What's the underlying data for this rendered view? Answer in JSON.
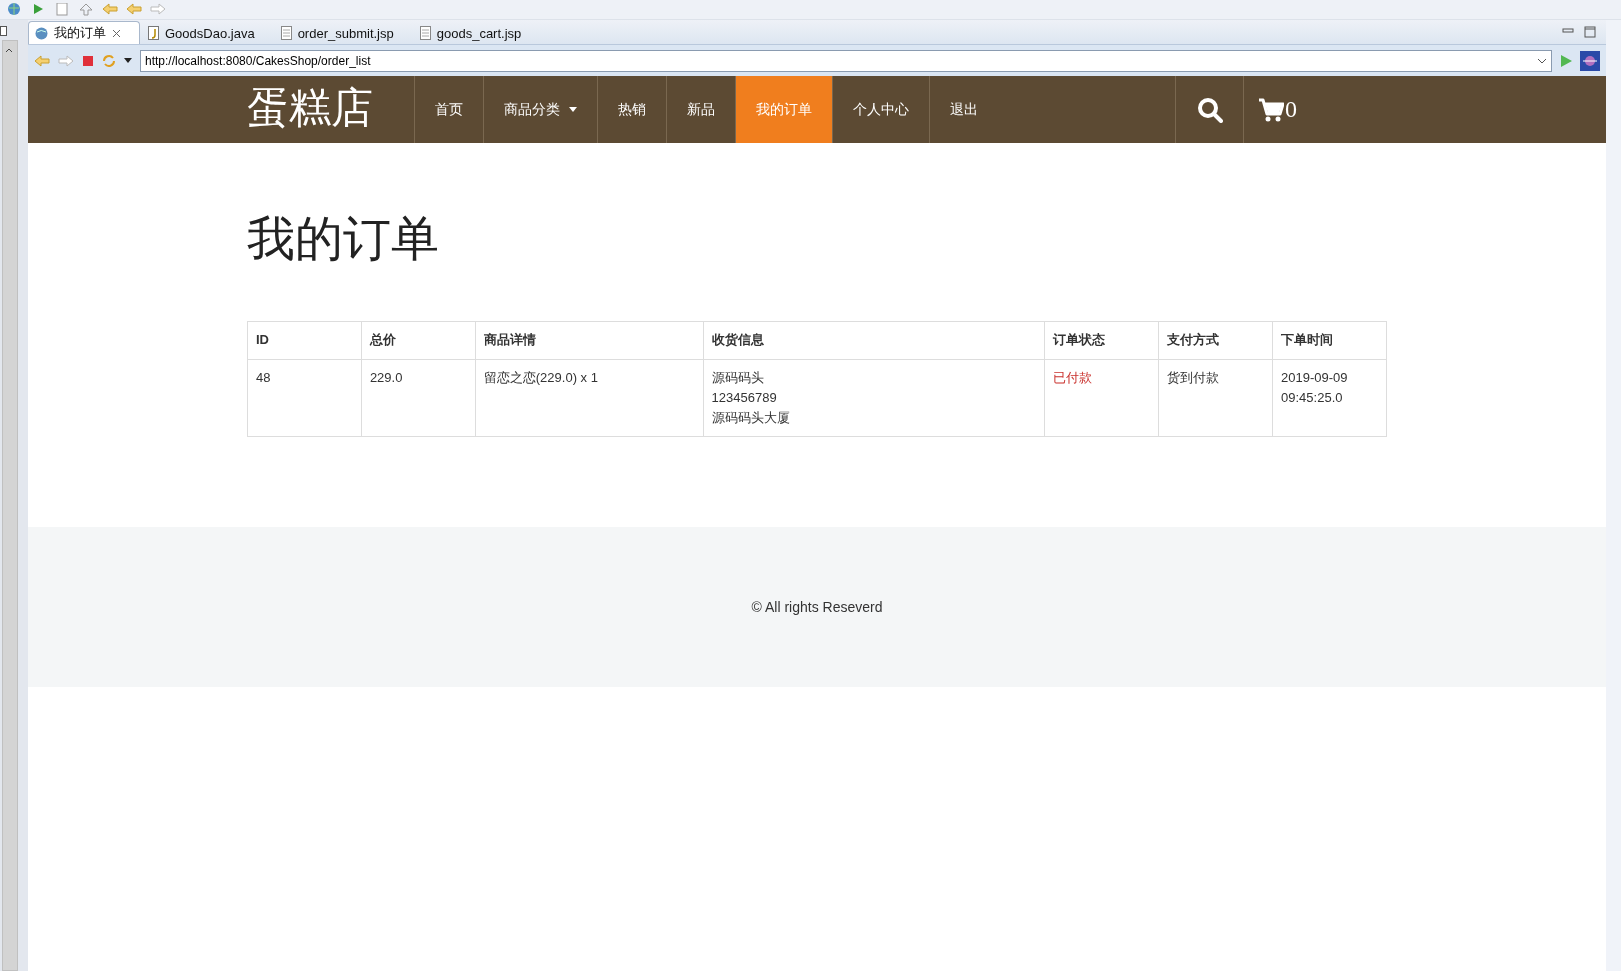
{
  "editor_tabs": [
    {
      "label": "我的订单",
      "kind": "browser",
      "selected": true,
      "closable": true
    },
    {
      "label": "GoodsDao.java",
      "kind": "java",
      "selected": false,
      "closable": false
    },
    {
      "label": "order_submit.jsp",
      "kind": "file",
      "selected": false,
      "closable": false
    },
    {
      "label": "goods_cart.jsp",
      "kind": "file",
      "selected": false,
      "closable": false
    }
  ],
  "address_bar": {
    "url": "http://localhost:8080/CakesShop/order_list"
  },
  "site": {
    "logo": "蛋糕店",
    "nav": [
      {
        "label": "首页",
        "kind": "link",
        "selected": false
      },
      {
        "label": "商品分类",
        "kind": "dropdown",
        "selected": false
      },
      {
        "label": "热销",
        "kind": "link",
        "selected": false
      },
      {
        "label": "新品",
        "kind": "link",
        "selected": false
      },
      {
        "label": "我的订单",
        "kind": "link",
        "selected": true
      },
      {
        "label": "个人中心",
        "kind": "link",
        "selected": false
      },
      {
        "label": "退出",
        "kind": "link",
        "selected": false
      }
    ],
    "cart_count": "0"
  },
  "page_title": "我的订单",
  "table": {
    "columns": [
      "ID",
      "总价",
      "商品详情",
      "收货信息",
      "订单状态",
      "支付方式",
      "下单时间"
    ],
    "rows": [
      {
        "id": "48",
        "total": "229.0",
        "items": "留恋之恋(229.0) x 1",
        "shipping": [
          "源码码头",
          "123456789",
          "源码码头大厦"
        ],
        "status": "已付款",
        "payment": "货到付款",
        "time": "2019-09-09 09:45:25.0"
      }
    ]
  },
  "footer": {
    "text": "© All rights Reseverd"
  }
}
